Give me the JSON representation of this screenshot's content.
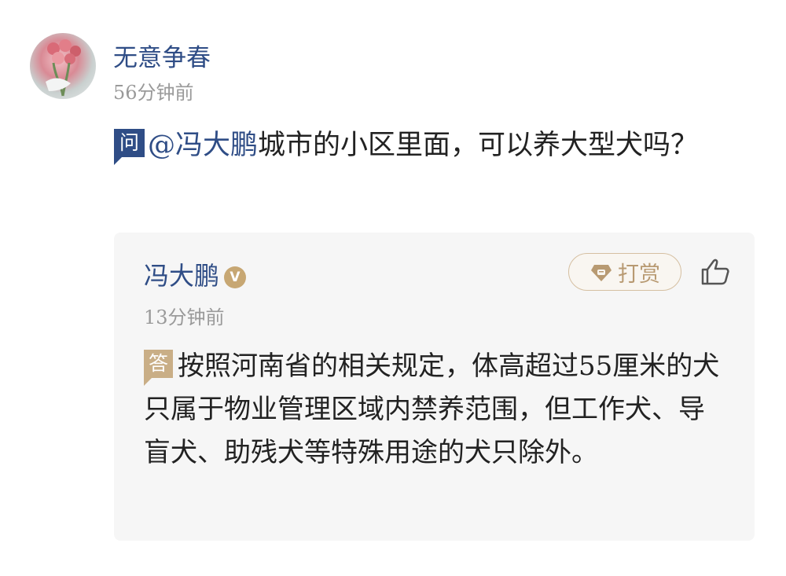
{
  "question_post": {
    "username": "无意争春",
    "time": "56分钟前",
    "badge": "问",
    "mention": "@冯大鹏",
    "text": "城市的小区里面，可以养大型犬吗？"
  },
  "answer": {
    "author": "冯大鹏",
    "verified_badge": "V",
    "reward_label": "打赏",
    "time": "13分钟前",
    "badge": "答",
    "text": "按照河南省的相关规定，体高超过55厘米的犬只属于物业管理区域内禁养范围，但工作犬、导盲犬、助残犬等特殊用途的犬只除外。"
  },
  "icons": {
    "avatar": "avatar-flowers-icon",
    "reward": "diamond-icon",
    "like": "thumbs-up-icon"
  },
  "colors": {
    "link_blue": "#2f4d86",
    "gold": "#c9ae86",
    "card_bg": "#f6f6f6",
    "meta_gray": "#9a9a9a"
  }
}
